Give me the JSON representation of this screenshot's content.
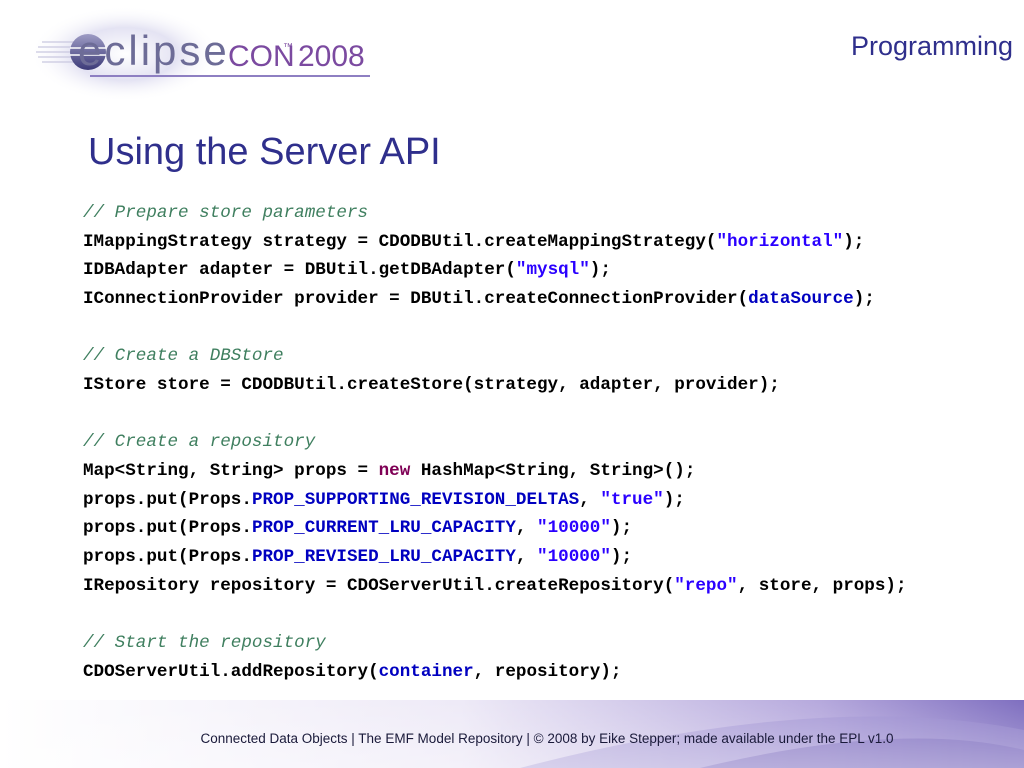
{
  "logo": {
    "text_main": "eclipse",
    "text_con": "CON",
    "text_tm": "™",
    "text_year": "2008"
  },
  "section": "Programming",
  "title": "Using the Server API",
  "code": [
    [
      {
        "t": "// Prepare store parameters",
        "c": "comment"
      }
    ],
    [
      {
        "t": "IMappingStrategy strategy = CDODBUtil.createMappingStrategy("
      },
      {
        "t": "\"horizontal\"",
        "c": "str"
      },
      {
        "t": ");"
      }
    ],
    [
      {
        "t": "IDBAdapter adapter = DBUtil.getDBAdapter("
      },
      {
        "t": "\"mysql\"",
        "c": "str"
      },
      {
        "t": ");"
      }
    ],
    [
      {
        "t": "IConnectionProvider provider = DBUtil.createConnectionProvider("
      },
      {
        "t": "dataSource",
        "c": "field"
      },
      {
        "t": ");"
      }
    ],
    [],
    [
      {
        "t": "// Create a DBStore",
        "c": "comment"
      }
    ],
    [
      {
        "t": "IStore store = CDODBUtil.createStore(strategy, adapter, provider);"
      }
    ],
    [],
    [
      {
        "t": "// Create a repository",
        "c": "comment"
      }
    ],
    [
      {
        "t": "Map<String, String> props = "
      },
      {
        "t": "new",
        "c": "kw"
      },
      {
        "t": " HashMap<String, String>();"
      }
    ],
    [
      {
        "t": "props.put(Props."
      },
      {
        "t": "PROP_SUPPORTING_REVISION_DELTAS",
        "c": "field"
      },
      {
        "t": ", "
      },
      {
        "t": "\"true\"",
        "c": "str"
      },
      {
        "t": ");"
      }
    ],
    [
      {
        "t": "props.put(Props."
      },
      {
        "t": "PROP_CURRENT_LRU_CAPACITY",
        "c": "field"
      },
      {
        "t": ", "
      },
      {
        "t": "\"10000\"",
        "c": "str"
      },
      {
        "t": ");"
      }
    ],
    [
      {
        "t": "props.put(Props."
      },
      {
        "t": "PROP_REVISED_LRU_CAPACITY",
        "c": "field"
      },
      {
        "t": ", "
      },
      {
        "t": "\"10000\"",
        "c": "str"
      },
      {
        "t": ");"
      }
    ],
    [
      {
        "t": "IRepository repository = CDOServerUtil.createRepository("
      },
      {
        "t": "\"repo\"",
        "c": "str"
      },
      {
        "t": ", store, props);"
      }
    ],
    [],
    [
      {
        "t": "// Start the repository",
        "c": "comment"
      }
    ],
    [
      {
        "t": "CDOServerUtil.addRepository("
      },
      {
        "t": "container",
        "c": "field"
      },
      {
        "t": ", repository);"
      }
    ]
  ],
  "footer": "Connected Data Objects  |  The EMF Model Repository  |  © 2008 by Eike Stepper; made available under the EPL v1.0",
  "colors": {
    "title": "#2f2f8c",
    "comment": "#3f7f5f",
    "string": "#2a00ff",
    "field": "#0000c0",
    "keyword": "#7f0055",
    "logo_con": "#7b4aa0",
    "footer_band": "#8a7ec8"
  }
}
